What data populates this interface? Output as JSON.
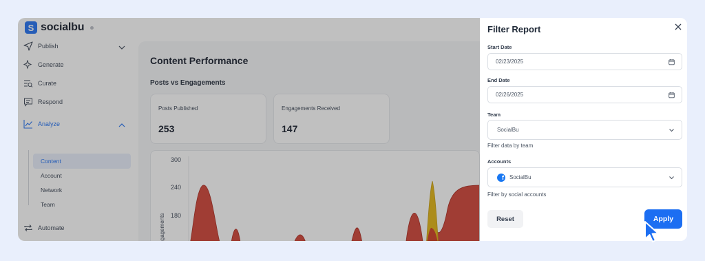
{
  "app": {
    "logo_text": "socialbu",
    "sidebar": {
      "items": [
        {
          "label": "Publish",
          "icon": "send-icon"
        },
        {
          "label": "Generate",
          "icon": "sparkle-icon"
        },
        {
          "label": "Curate",
          "icon": "curate-icon"
        },
        {
          "label": "Respond",
          "icon": "chat-icon"
        },
        {
          "label": "Analyze",
          "icon": "chart-icon"
        },
        {
          "label": "Automate",
          "icon": "repeat-icon"
        }
      ],
      "analyze_sub": [
        "Content",
        "Account",
        "Network",
        "Team"
      ]
    },
    "main": {
      "title": "Content Performance",
      "section": "Posts vs Engagements",
      "cards": [
        {
          "label": "Posts Published",
          "value": "253"
        },
        {
          "label": "Engagements Received",
          "value": "147"
        }
      ]
    }
  },
  "drawer": {
    "title": "Filter Report",
    "start_date_label": "Start Date",
    "start_date": "02/23/2025",
    "end_date_label": "End Date",
    "end_date": "02/26/2025",
    "team_label": "Team",
    "team_value": "SocialBu",
    "team_help": "Filter data by team",
    "accounts_label": "Accounts",
    "accounts_value": "SocialBu",
    "accounts_help": "Filter by social accounts",
    "reset_label": "Reset",
    "apply_label": "Apply"
  },
  "chart_data": {
    "type": "area",
    "ylabel": "Engagements",
    "y_ticks": [
      "300",
      "240",
      "180"
    ],
    "colors": {
      "series_red": "#cc2f20",
      "series_yellow": "#e2b30c"
    }
  },
  "colors": {
    "accent": "#1c6ef2",
    "background": "#e9effc"
  }
}
